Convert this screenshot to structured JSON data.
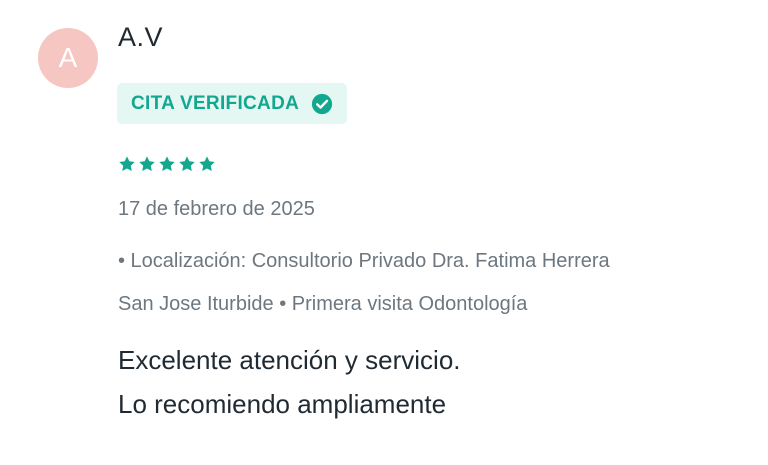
{
  "review": {
    "avatar_initial": "A",
    "author": "A.V",
    "badge_label": "CITA VERIFICADA",
    "badge_icon": "check-circle-icon",
    "rating": 5,
    "rating_max": 5,
    "date": "17 de febrero de 2025",
    "meta_line_1": "• Localización: Consultorio Privado Dra. Fatima Herrera",
    "meta_line_2": "San Jose Iturbide • Primera visita Odontología",
    "comment_line_1": "Excelente atención y servicio.",
    "comment_line_2": "Lo recomiendo ampliamente"
  },
  "colors": {
    "accent": "#11a88f",
    "badge_bg": "#e4f7f3",
    "avatar_bg": "#f6c6c2",
    "muted_text": "#6d7780",
    "main_text": "#1f2a33"
  }
}
